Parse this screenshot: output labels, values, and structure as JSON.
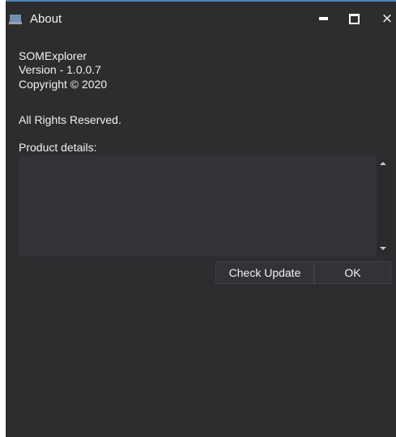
{
  "window": {
    "title": "About",
    "controls": {
      "minimize_icon": "minimize-icon",
      "maximize_icon": "maximize-icon",
      "close_icon": "close-icon",
      "close_glyph": "×"
    },
    "app_icon": "window-icon"
  },
  "about": {
    "product_name": "SOMExplorer",
    "version": "Version - 1.0.0.7",
    "copyright": "Copyright ©  2020",
    "rights": "All Rights Reserved.",
    "details_label": "Product details:",
    "details_value": ""
  },
  "buttons": {
    "check_update": "Check Update",
    "ok": "OK"
  },
  "colors": {
    "background": "#2d2d30",
    "text": "#f1f1f1",
    "accent_border": "#5a7fb0"
  }
}
